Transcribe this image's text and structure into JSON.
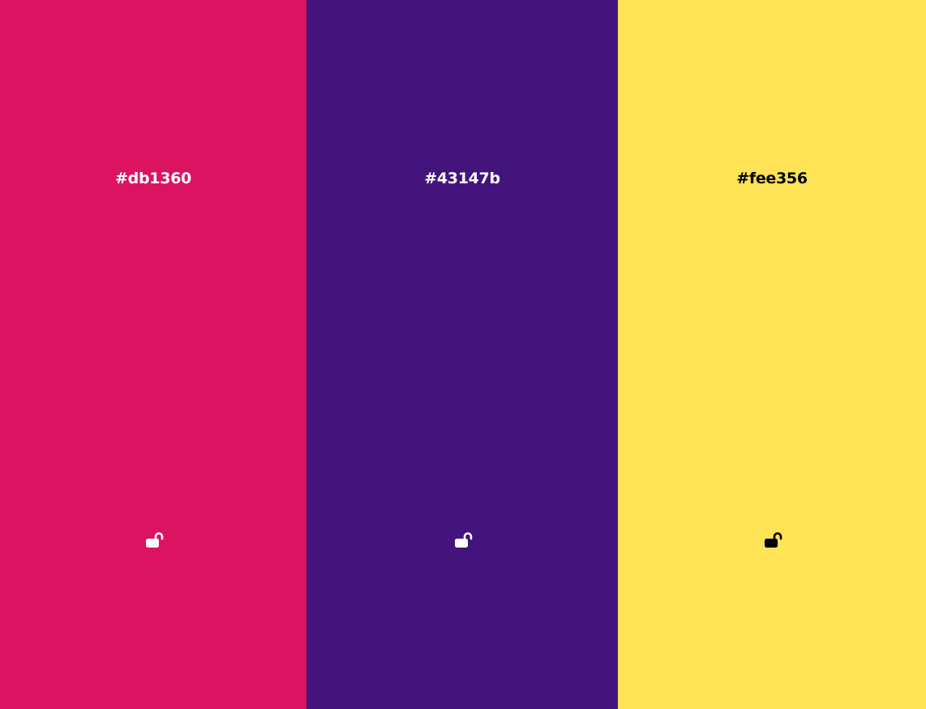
{
  "swatches": [
    {
      "hex": "#db1360",
      "color": "#db1360",
      "text_color": "#ffffff",
      "lock_icon": "lock-open-icon",
      "locked": false
    },
    {
      "hex": "#43147b",
      "color": "#43147b",
      "text_color": "#ffffff",
      "lock_icon": "lock-open-icon",
      "locked": false
    },
    {
      "hex": "#fee356",
      "color": "#fee356",
      "text_color": "#000000",
      "lock_icon": "lock-open-icon",
      "locked": false
    }
  ]
}
